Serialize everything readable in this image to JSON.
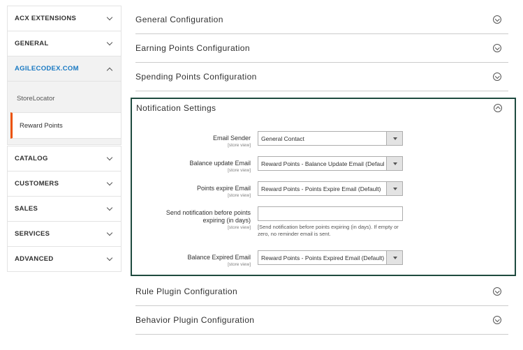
{
  "sidebar": {
    "items_top": [
      {
        "label": "ACX EXTENSIONS"
      },
      {
        "label": "GENERAL"
      },
      {
        "label": "AGILECODEX.COM"
      }
    ],
    "sub_items": [
      {
        "label": "StoreLocator"
      },
      {
        "label": "Reward Points"
      }
    ],
    "items_bottom": [
      {
        "label": "CATALOG"
      },
      {
        "label": "CUSTOMERS"
      },
      {
        "label": "SALES"
      },
      {
        "label": "SERVICES"
      },
      {
        "label": "ADVANCED"
      }
    ],
    "active_color": "#1979c3",
    "current_marker_color": "#eb5202"
  },
  "main": {
    "sections_top": [
      {
        "title": "General Configuration"
      },
      {
        "title": "Earning Points Configuration"
      },
      {
        "title": "Spending Points Configuration"
      }
    ],
    "open_section": {
      "title": "Notification Settings",
      "fields": [
        {
          "label": "Email Sender",
          "scope": "[store view]",
          "value": "General Contact"
        },
        {
          "label": "Balance update Email",
          "scope": "[store view]",
          "value": "Reward Points - Balance Update Email (Default)"
        },
        {
          "label": "Points expire Email",
          "scope": "[store view]",
          "value": "Reward Points - Points Expire Email (Default)"
        },
        {
          "label_line1": "Send notification before points",
          "label_line2": "expiring (in days)",
          "scope": "[store view]",
          "value": "",
          "note": "[Send notification before points expiring (in days). If empty or zero, no reminder email is sent."
        },
        {
          "label": "Balance Expired Email",
          "scope": "[store view]",
          "value": "Reward Points - Points Expired Email (Default)"
        }
      ]
    },
    "sections_bottom": [
      {
        "title": "Rule Plugin Configuration"
      },
      {
        "title": "Behavior Plugin Configuration"
      }
    ],
    "highlight_border_color": "#1e4a3f"
  }
}
